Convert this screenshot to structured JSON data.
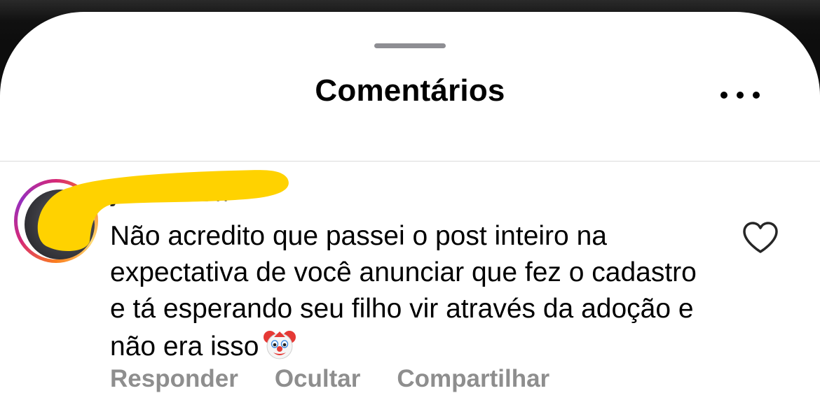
{
  "sheet": {
    "title": "Comentários",
    "more_icon": "more-horizontal-icon"
  },
  "comment": {
    "username": "juliavi",
    "timestamp": "22 h",
    "text": "Não acredito que passei o post inteiro na expectativa de você anunciar que fez o cadastro e tá esperando seu filho vir através da adoção e não era isso",
    "emoji_icon": "clown-face-icon",
    "like_icon": "heart-outline-icon",
    "actions": {
      "reply": "Responder",
      "hide": "Ocultar",
      "share": "Compartilhar"
    }
  },
  "colors": {
    "redaction": "#FFD200",
    "secondary_text": "#8e8e8e",
    "divider": "#dbdbdb"
  }
}
